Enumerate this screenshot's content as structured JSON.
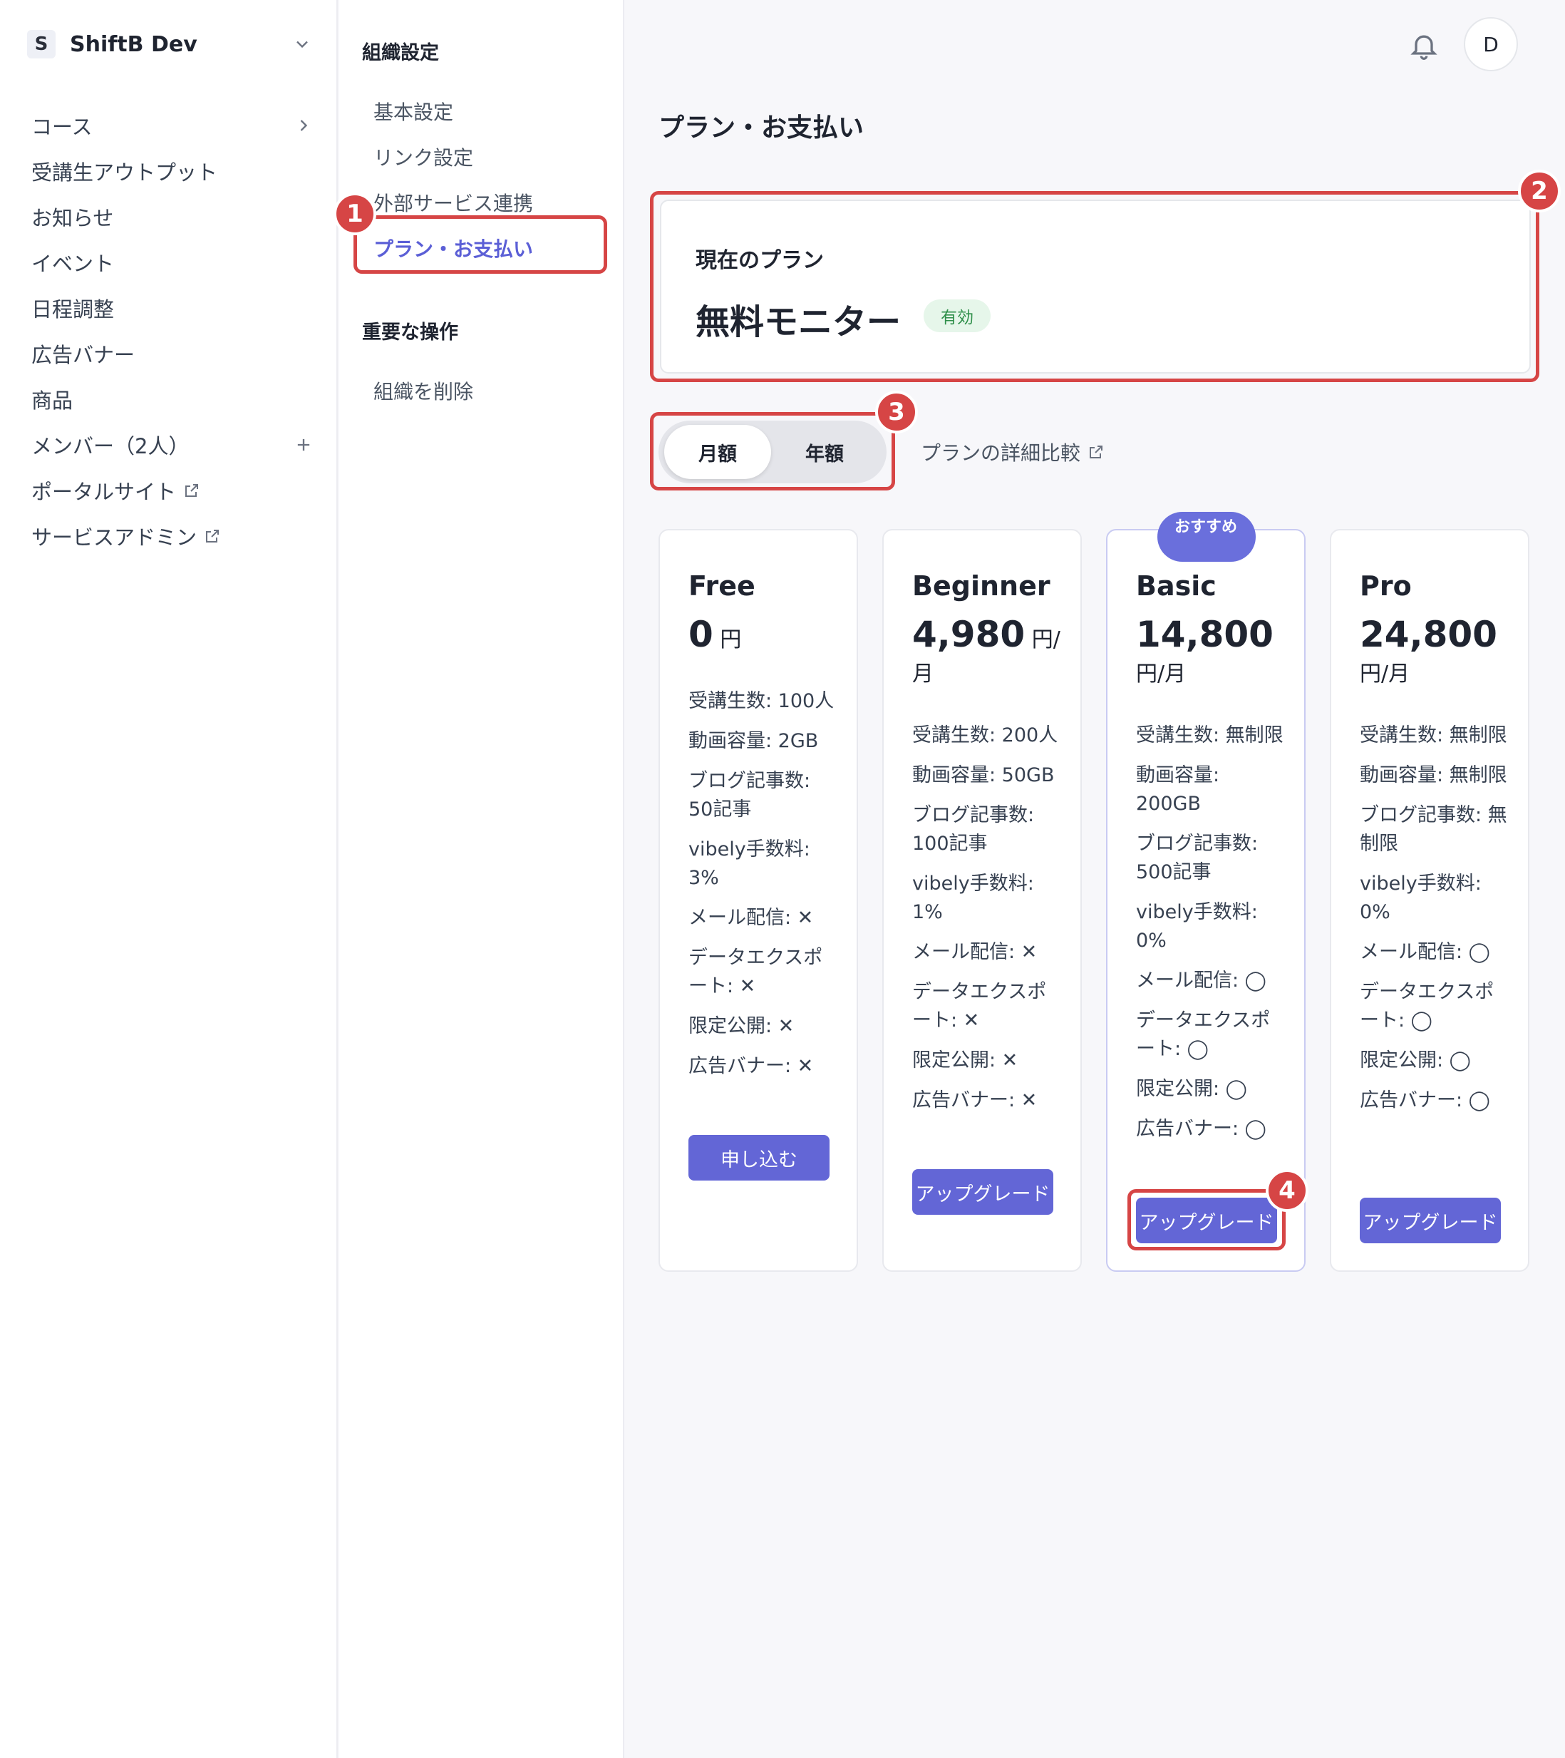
{
  "org": {
    "initial": "S",
    "name": "ShiftB Dev"
  },
  "nav": {
    "courses": "コース",
    "outputs": "受講生アウトプット",
    "news": "お知らせ",
    "events": "イベント",
    "schedule": "日程調整",
    "ads": "広告バナー",
    "products": "商品",
    "members": "メンバー（2人）",
    "portal": "ポータルサイト",
    "admin": "サービスアドミン"
  },
  "settings": {
    "heading": "組織設定",
    "basic": "基本設定",
    "links": "リンク設定",
    "external": "外部サービス連携",
    "billing": "プラン・お支払い",
    "danger_heading": "重要な操作",
    "delete": "組織を削除"
  },
  "header": {
    "avatar": "D"
  },
  "page": {
    "title": "プラン・お支払い"
  },
  "current_plan": {
    "label": "現在のプラン",
    "name": "無料モニター",
    "status": "有効"
  },
  "billing_toggle": {
    "monthly": "月額",
    "yearly": "年額"
  },
  "compare_link": "プランの詳細比較",
  "annotations": [
    "1",
    "2",
    "3",
    "4"
  ],
  "plans": [
    {
      "name": "Free",
      "price": "0",
      "unit": "円",
      "features": [
        "受講生数: 100人",
        "動画容量: 2GB",
        "ブログ記事数: 50記事",
        "vibely手数料: 3%",
        "メール配信: ✕",
        "データエクスポート: ✕",
        "限定公開: ✕",
        "広告バナー: ✕"
      ],
      "cta": "申し込む"
    },
    {
      "name": "Beginner",
      "price": "4,980",
      "unit": "円/月",
      "features": [
        "受講生数: 200人",
        "動画容量: 50GB",
        "ブログ記事数: 100記事",
        "vibely手数料: 1%",
        "メール配信: ✕",
        "データエクスポート: ✕",
        "限定公開: ✕",
        "広告バナー: ✕"
      ],
      "cta": "アップグレード"
    },
    {
      "name": "Basic",
      "price": "14,800",
      "unit": "円/月",
      "badge": "おすすめ",
      "features": [
        "受講生数: 無制限",
        "動画容量: 200GB",
        "ブログ記事数: 500記事",
        "vibely手数料: 0%",
        "メール配信: ◯",
        "データエクスポート: ◯",
        "限定公開: ◯",
        "広告バナー: ◯"
      ],
      "cta": "アップグレード"
    },
    {
      "name": "Pro",
      "price": "24,800",
      "unit": "円/月",
      "features": [
        "受講生数: 無制限",
        "動画容量: 無制限",
        "ブログ記事数: 無制限",
        "vibely手数料: 0%",
        "メール配信: ◯",
        "データエクスポート: ◯",
        "限定公開: ◯",
        "広告バナー: ◯"
      ],
      "cta": "アップグレード"
    }
  ],
  "colors": {
    "accent": "#6366d6",
    "highlight": "#d64545",
    "status_bg": "#e6f6ea"
  }
}
